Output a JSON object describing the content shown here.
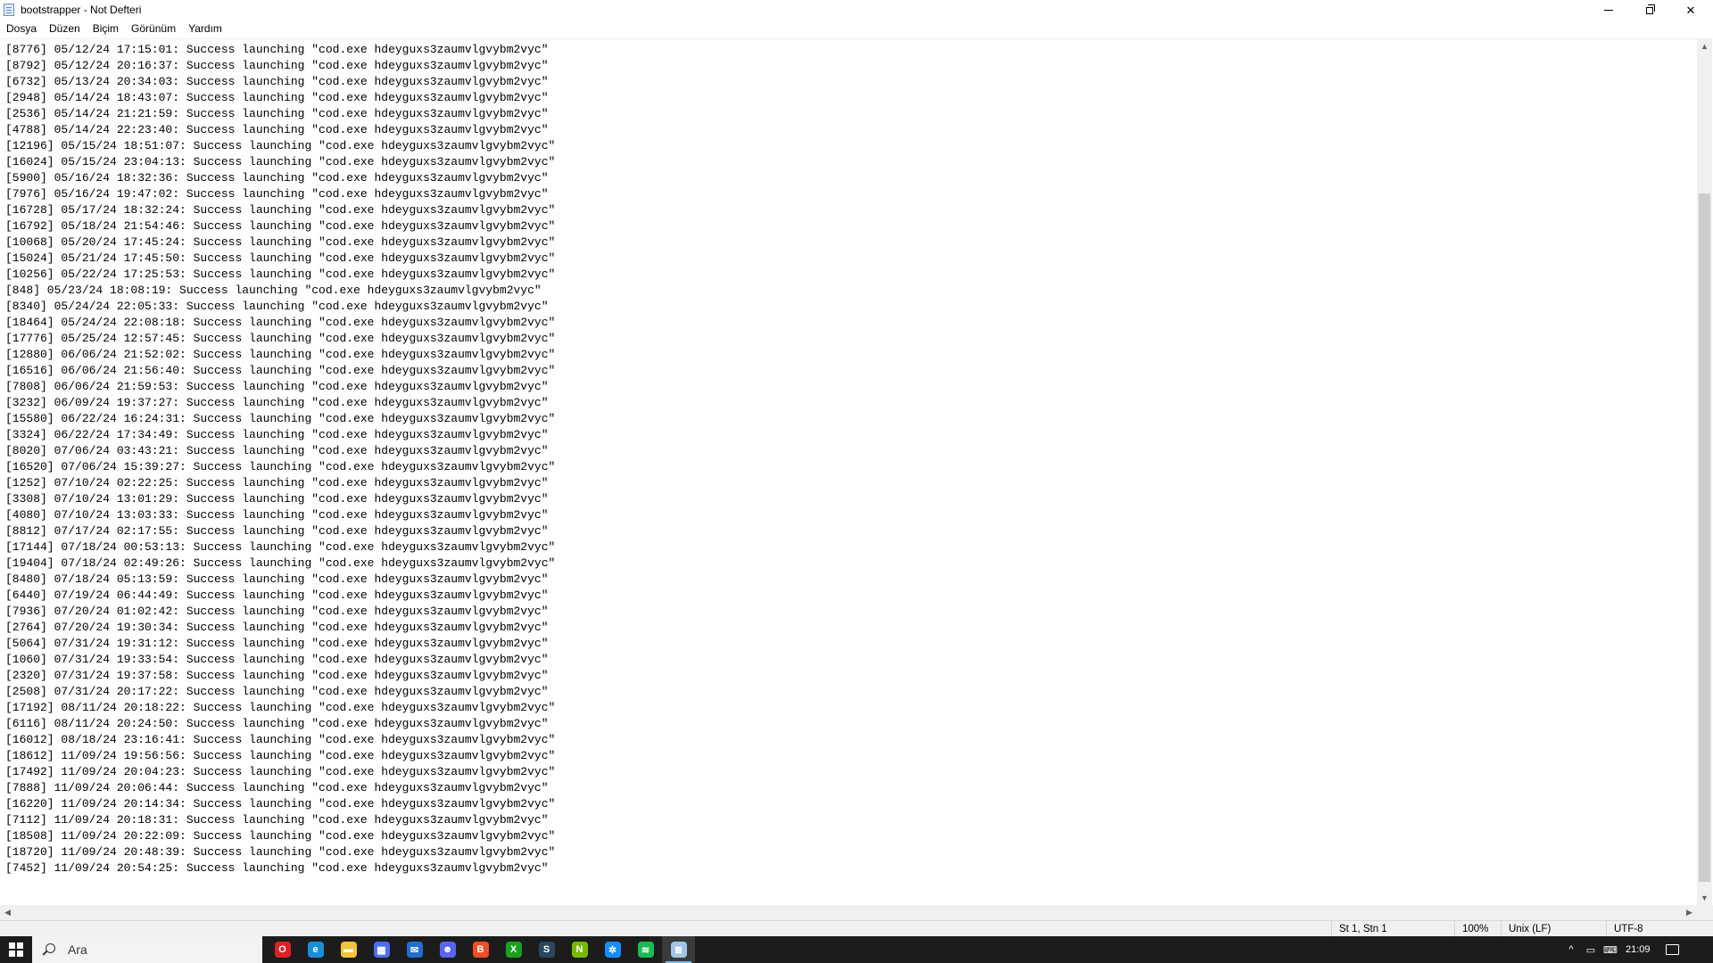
{
  "window": {
    "title": "bootstrapper - Not Defteri",
    "minimize_glyph": "",
    "close_glyph": "✕"
  },
  "menu": [
    {
      "label": "Dosya"
    },
    {
      "label": "Düzen"
    },
    {
      "label": "Biçim"
    },
    {
      "label": "Görünüm"
    },
    {
      "label": "Yardım"
    }
  ],
  "editor": {
    "lines": [
      "[8776] 05/12/24 17:15:01: Success launching \"cod.exe hdeyguxs3zaumvlgvybm2vyc\"",
      "[8792] 05/12/24 20:16:37: Success launching \"cod.exe hdeyguxs3zaumvlgvybm2vyc\"",
      "[6732] 05/13/24 20:34:03: Success launching \"cod.exe hdeyguxs3zaumvlgvybm2vyc\"",
      "[2948] 05/14/24 18:43:07: Success launching \"cod.exe hdeyguxs3zaumvlgvybm2vyc\"",
      "[2536] 05/14/24 21:21:59: Success launching \"cod.exe hdeyguxs3zaumvlgvybm2vyc\"",
      "[4788] 05/14/24 22:23:40: Success launching \"cod.exe hdeyguxs3zaumvlgvybm2vyc\"",
      "[12196] 05/15/24 18:51:07: Success launching \"cod.exe hdeyguxs3zaumvlgvybm2vyc\"",
      "[16024] 05/15/24 23:04:13: Success launching \"cod.exe hdeyguxs3zaumvlgvybm2vyc\"",
      "[5900] 05/16/24 18:32:36: Success launching \"cod.exe hdeyguxs3zaumvlgvybm2vyc\"",
      "[7976] 05/16/24 19:47:02: Success launching \"cod.exe hdeyguxs3zaumvlgvybm2vyc\"",
      "[16728] 05/17/24 18:32:24: Success launching \"cod.exe hdeyguxs3zaumvlgvybm2vyc\"",
      "[16792] 05/18/24 21:54:46: Success launching \"cod.exe hdeyguxs3zaumvlgvybm2vyc\"",
      "[10068] 05/20/24 17:45:24: Success launching \"cod.exe hdeyguxs3zaumvlgvybm2vyc\"",
      "[15024] 05/21/24 17:45:50: Success launching \"cod.exe hdeyguxs3zaumvlgvybm2vyc\"",
      "[10256] 05/22/24 17:25:53: Success launching \"cod.exe hdeyguxs3zaumvlgvybm2vyc\"",
      "[848] 05/23/24 18:08:19: Success launching \"cod.exe hdeyguxs3zaumvlgvybm2vyc\"",
      "[8340] 05/24/24 22:05:33: Success launching \"cod.exe hdeyguxs3zaumvlgvybm2vyc\"",
      "[18464] 05/24/24 22:08:18: Success launching \"cod.exe hdeyguxs3zaumvlgvybm2vyc\"",
      "[17776] 05/25/24 12:57:45: Success launching \"cod.exe hdeyguxs3zaumvlgvybm2vyc\"",
      "[12880] 06/06/24 21:52:02: Success launching \"cod.exe hdeyguxs3zaumvlgvybm2vyc\"",
      "[16516] 06/06/24 21:56:40: Success launching \"cod.exe hdeyguxs3zaumvlgvybm2vyc\"",
      "[7808] 06/06/24 21:59:53: Success launching \"cod.exe hdeyguxs3zaumvlgvybm2vyc\"",
      "[3232] 06/09/24 19:37:27: Success launching \"cod.exe hdeyguxs3zaumvlgvybm2vyc\"",
      "[15580] 06/22/24 16:24:31: Success launching \"cod.exe hdeyguxs3zaumvlgvybm2vyc\"",
      "[3324] 06/22/24 17:34:49: Success launching \"cod.exe hdeyguxs3zaumvlgvybm2vyc\"",
      "[8020] 07/06/24 03:43:21: Success launching \"cod.exe hdeyguxs3zaumvlgvybm2vyc\"",
      "[16520] 07/06/24 15:39:27: Success launching \"cod.exe hdeyguxs3zaumvlgvybm2vyc\"",
      "[1252] 07/10/24 02:22:25: Success launching \"cod.exe hdeyguxs3zaumvlgvybm2vyc\"",
      "[3308] 07/10/24 13:01:29: Success launching \"cod.exe hdeyguxs3zaumvlgvybm2vyc\"",
      "[4080] 07/10/24 13:03:33: Success launching \"cod.exe hdeyguxs3zaumvlgvybm2vyc\"",
      "[8812] 07/17/24 02:17:55: Success launching \"cod.exe hdeyguxs3zaumvlgvybm2vyc\"",
      "[17144] 07/18/24 00:53:13: Success launching \"cod.exe hdeyguxs3zaumvlgvybm2vyc\"",
      "[19404] 07/18/24 02:49:26: Success launching \"cod.exe hdeyguxs3zaumvlgvybm2vyc\"",
      "[8480] 07/18/24 05:13:59: Success launching \"cod.exe hdeyguxs3zaumvlgvybm2vyc\"",
      "[6440] 07/19/24 06:44:49: Success launching \"cod.exe hdeyguxs3zaumvlgvybm2vyc\"",
      "[7936] 07/20/24 01:02:42: Success launching \"cod.exe hdeyguxs3zaumvlgvybm2vyc\"",
      "[2764] 07/20/24 19:30:34: Success launching \"cod.exe hdeyguxs3zaumvlgvybm2vyc\"",
      "[5064] 07/31/24 19:31:12: Success launching \"cod.exe hdeyguxs3zaumvlgvybm2vyc\"",
      "[1060] 07/31/24 19:33:54: Success launching \"cod.exe hdeyguxs3zaumvlgvybm2vyc\"",
      "[2320] 07/31/24 19:37:58: Success launching \"cod.exe hdeyguxs3zaumvlgvybm2vyc\"",
      "[2508] 07/31/24 20:17:22: Success launching \"cod.exe hdeyguxs3zaumvlgvybm2vyc\"",
      "[17192] 08/11/24 20:18:22: Success launching \"cod.exe hdeyguxs3zaumvlgvybm2vyc\"",
      "[6116] 08/11/24 20:24:50: Success launching \"cod.exe hdeyguxs3zaumvlgvybm2vyc\"",
      "[16012] 08/18/24 23:16:41: Success launching \"cod.exe hdeyguxs3zaumvlgvybm2vyc\"",
      "[18612] 11/09/24 19:56:56: Success launching \"cod.exe hdeyguxs3zaumvlgvybm2vyc\"",
      "[17492] 11/09/24 20:04:23: Success launching \"cod.exe hdeyguxs3zaumvlgvybm2vyc\"",
      "[7888] 11/09/24 20:06:44: Success launching \"cod.exe hdeyguxs3zaumvlgvybm2vyc\"",
      "[16220] 11/09/24 20:14:34: Success launching \"cod.exe hdeyguxs3zaumvlgvybm2vyc\"",
      "[7112] 11/09/24 20:18:31: Success launching \"cod.exe hdeyguxs3zaumvlgvybm2vyc\"",
      "[18508] 11/09/24 20:22:09: Success launching \"cod.exe hdeyguxs3zaumvlgvybm2vyc\"",
      "[18720] 11/09/24 20:48:39: Success launching \"cod.exe hdeyguxs3zaumvlgvybm2vyc\"",
      "[7452] 11/09/24 20:54:25: Success launching \"cod.exe hdeyguxs3zaumvlgvybm2vyc\""
    ]
  },
  "scrollbars": {
    "up": "▲",
    "down": "▼",
    "left": "◀",
    "right": "▶"
  },
  "status": {
    "position": "St 1, Stn 1",
    "zoom": "100%",
    "line_ending": "Unix (LF)",
    "encoding": "UTF-8"
  },
  "taskbar": {
    "search_placeholder": "Ara",
    "apps": [
      {
        "icon": "opera-icon",
        "glyph": "O",
        "color": "#e01f26",
        "active": false
      },
      {
        "icon": "edge-icon",
        "glyph": "e",
        "color": "#1a8fd8",
        "active": false
      },
      {
        "icon": "file-explorer-icon",
        "glyph": "▬",
        "color": "#f2c437",
        "active": false
      },
      {
        "icon": "store-icon",
        "glyph": "▦",
        "color": "#4e6ef2",
        "active": false
      },
      {
        "icon": "mail-icon",
        "glyph": "✉",
        "color": "#1f6fcf",
        "active": false
      },
      {
        "icon": "discord-icon",
        "glyph": "☻",
        "color": "#5865f2",
        "active": false
      },
      {
        "icon": "brave-icon",
        "glyph": "B",
        "color": "#f04e23",
        "active": false
      },
      {
        "icon": "xbox-icon",
        "glyph": "X",
        "color": "#19a11d",
        "active": false
      },
      {
        "icon": "steam-icon",
        "glyph": "S",
        "color": "#2a475e",
        "active": false
      },
      {
        "icon": "nvidia-icon",
        "glyph": "N",
        "color": "#76b900",
        "active": false
      },
      {
        "icon": "battlenet-icon",
        "glyph": "✲",
        "color": "#148eff",
        "active": false
      },
      {
        "icon": "spotify-icon",
        "glyph": "≋",
        "color": "#1db954",
        "active": false
      },
      {
        "icon": "notepad-icon",
        "glyph": "≣",
        "color": "#9fc5e8",
        "active": true
      }
    ],
    "tray": {
      "chevron": "^",
      "network": "▭",
      "keyboard": "⌨",
      "time": "21:09"
    }
  }
}
